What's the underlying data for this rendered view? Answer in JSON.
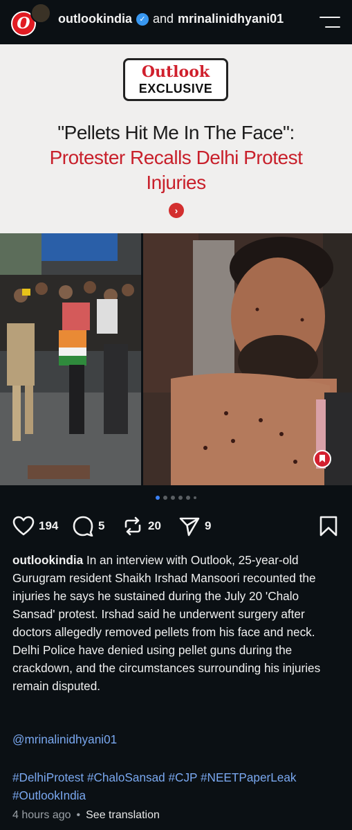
{
  "header": {
    "username": "outlookindia",
    "joiner": "and",
    "collaborator": "mrinalinidhyani01",
    "avatar_letter": "O"
  },
  "banner": {
    "brand": "Outlook",
    "exclusive": "EXCLUSIVE",
    "headline_black": "\"Pellets Hit Me In The Face\":",
    "headline_red": "Protester Recalls Delhi Protest Injuries",
    "arrow": "›"
  },
  "carousel": {
    "count": 6,
    "active": 0
  },
  "actions": {
    "likes": "194",
    "comments": "5",
    "reposts": "20",
    "shares": "9"
  },
  "caption": {
    "username": "outlookindia",
    "text": "In an interview with Outlook, 25-year-old Gurugram resident Shaikh Irshad Mansoori recounted the injuries he says he sustained during the July 20 'Chalo Sansad' protest. Irshad said he underwent surgery after doctors allegedly removed pellets from his face and neck. Delhi Police have denied using pellet guns during the crackdown, and the circumstances surrounding his injuries remain disputed."
  },
  "mention": "@mrinalinidhyani01",
  "hashtags": "#DelhiProtest #ChaloSansad #CJP #NEETPaperLeak #OutlookIndia",
  "meta": {
    "time": "4 hours ago",
    "separator": "•",
    "translate": "See translation"
  },
  "colors": {
    "background": "#0b1014",
    "accent_red": "#c8202b",
    "link_blue": "#7aa8f0",
    "verified_blue": "#3897f0"
  }
}
